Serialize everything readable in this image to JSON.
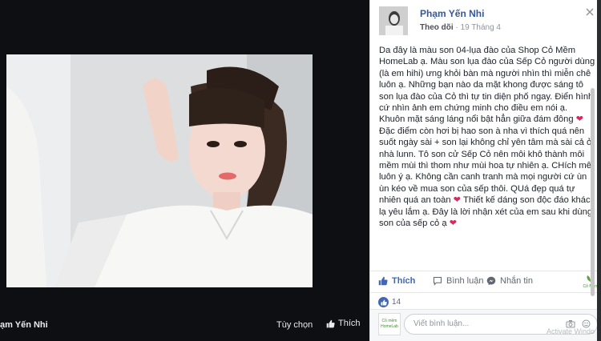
{
  "viewer": {
    "footer_name": "ạm Yến Nhi",
    "options_label": "Tùy chọn",
    "like_label": "Thích"
  },
  "post": {
    "author": "Phạm Yến Nhi",
    "follow_label": "Theo dõi",
    "separator": " · ",
    "date": "19 Tháng 4",
    "text_parts": [
      "Da đây là màu son 04-lụa đào của Shop Cỏ Mềm HomeLab ạ. Màu son lụa đào của Sếp Cỏ người dùng (là em hihi) ưng khỏi bàn mà người nhìn thì miễn chê luôn ạ. Những bạn nào da mặt khong được sáng tô son lụa đào của Cỏ thì tự tin diện phố ngay. Điển hình cứ nhìn ảnh em chứng minh cho điều em nói ạ. Khuôn mặt sáng láng nổi bật hẳn giữa đám đông ",
      " Đặc điểm còn hơi bị hao son à nha vì thích quá nên suốt ngày sài + son lại không chỉ yên tâm mà sài cả ở nhà lunn. Tô son cử Sếp Cỏ nên môi khô thành môi mềm mùi thì thom như mùi hoa tự nhiên ạ. CHích mê luôn ý ạ. Không cần canh tranh mà mọi người cứ ùn ùn kéo về mua son của sếp thôi. QUá đẹp quá tự nhiên quá an toàn ",
      " Thiết kế dáng son độc đáo khác lạ yêu lắm ạ. Đây là lời nhận xét của em sau khi dùng son của sếp cỏ ạ "
    ],
    "heart_glyph": "❤"
  },
  "actions": {
    "like_label": "Thích",
    "comment_label": "Bình luận",
    "share_label": "Nhắn tin",
    "page_badge": "Cỏ Mềm"
  },
  "reactions": {
    "count": "14"
  },
  "comment": {
    "avatar_text_1": "Cỏ mềm",
    "avatar_text_2": "HomeLab",
    "placeholder": "Viết bình luận...",
    "watermark": "Activate Windo"
  },
  "icons": {
    "like": "thumbs-up-icon",
    "comment": "speech-bubble-icon",
    "share": "messenger-icon",
    "camera": "camera-icon",
    "sticker": "sticker-icon",
    "close": "close-icon"
  },
  "colors": {
    "link_blue": "#365899",
    "fb_blue": "#4267b2",
    "heart_red": "#e0245e",
    "viewer_bg": "#0e0f12"
  }
}
